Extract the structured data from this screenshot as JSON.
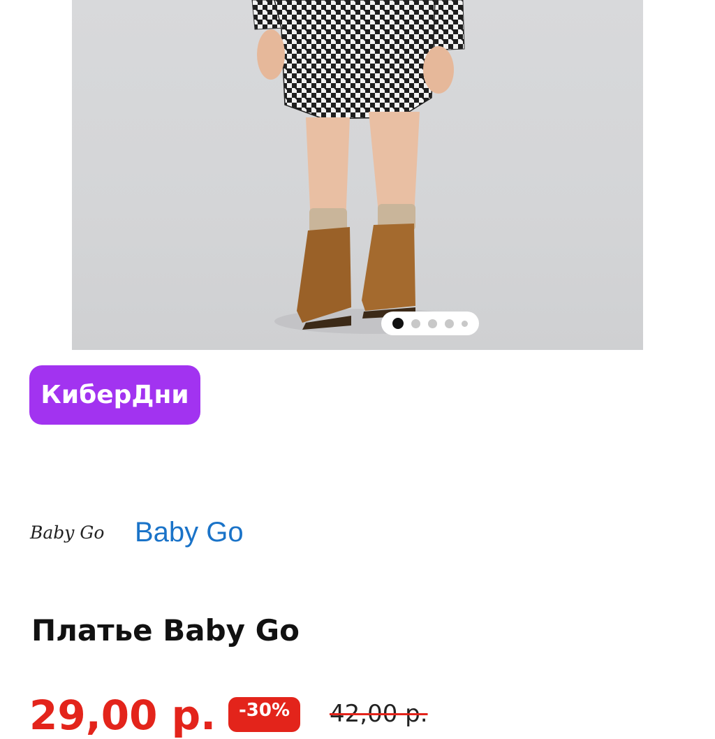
{
  "gallery": {
    "image_alt": "product-photo-dress",
    "dots_total": 5,
    "active_index": 0
  },
  "promo": {
    "label": "КиберДни",
    "color": "#a233f0"
  },
  "brand": {
    "logo_text": "Baby Go",
    "name": "Baby Go",
    "link_color": "#1a73c8"
  },
  "product": {
    "title": "Платье Baby Go"
  },
  "price": {
    "current": "29,00 р.",
    "discount": "-30%",
    "old": "42,00 р.",
    "accent_color": "#e3241b"
  }
}
